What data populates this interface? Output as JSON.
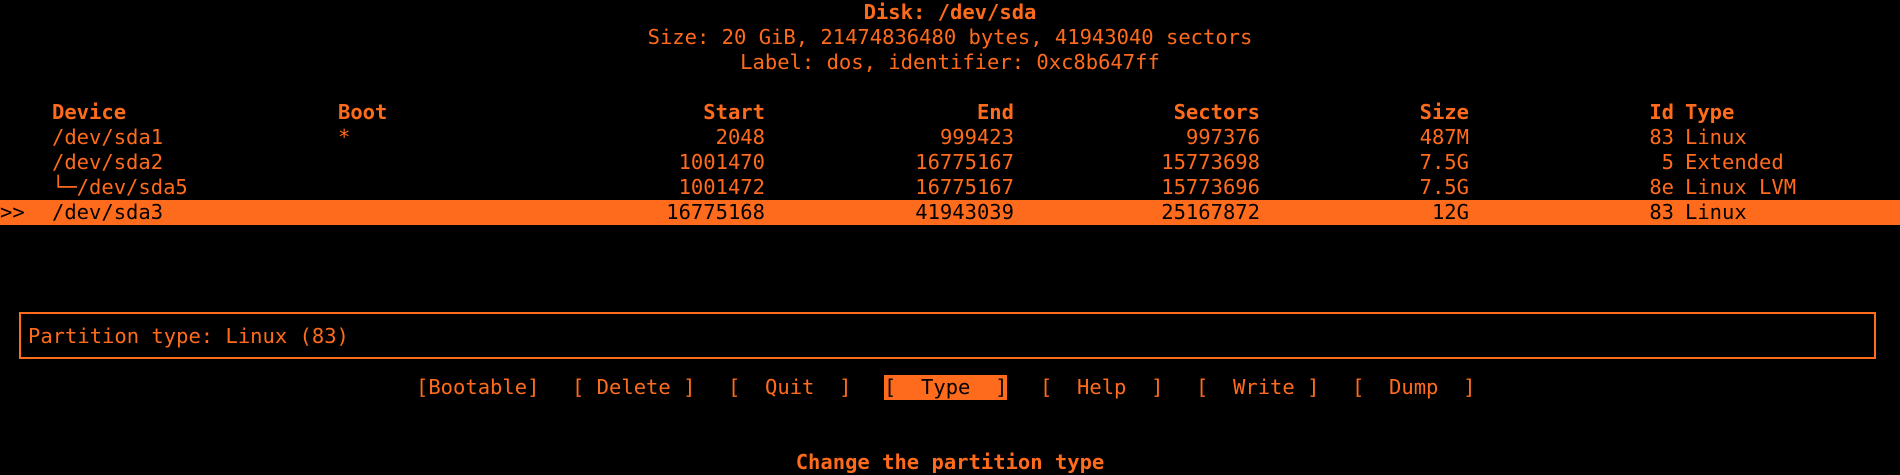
{
  "disk": {
    "title": "Disk: /dev/sda",
    "size_line": "Size: 20 GiB, 21474836480 bytes, 41943040 sectors",
    "label_line": "Label: dos, identifier: 0xc8b647ff"
  },
  "table": {
    "headers": {
      "device": "Device",
      "boot": "Boot",
      "start": "Start",
      "end": "End",
      "sectors": "Sectors",
      "size": "Size",
      "id": "Id",
      "type": "Type"
    },
    "rows": [
      {
        "marker": "",
        "device": "/dev/sda1",
        "boot": "*",
        "start": "2048",
        "end": "999423",
        "sectors": "997376",
        "size": "487M",
        "id": "83",
        "type": "Linux"
      },
      {
        "marker": "",
        "device": "/dev/sda2",
        "boot": "",
        "start": "1001470",
        "end": "16775167",
        "sectors": "15773698",
        "size": "7.5G",
        "id": "5",
        "type": "Extended"
      },
      {
        "marker": "",
        "device": "└─/dev/sda5",
        "boot": "",
        "start": "1001472",
        "end": "16775167",
        "sectors": "15773696",
        "size": "7.5G",
        "id": "8e",
        "type": "Linux LVM"
      },
      {
        "marker": ">>",
        "device": "/dev/sda3",
        "boot": "",
        "start": "16775168",
        "end": "41943039",
        "sectors": "25167872",
        "size": "12G",
        "id": "83",
        "type": "Linux"
      }
    ]
  },
  "info": {
    "text": "Partition type: Linux (83)"
  },
  "menu": {
    "bootable": "[Bootable]",
    "delete": "[ Delete ]",
    "quit": "[  Quit  ]",
    "type": "[  Type  ]",
    "help": "[  Help  ]",
    "write": "[  Write ]",
    "dump": "[  Dump  ]"
  },
  "footer": {
    "hint": "Change the partition type"
  },
  "colors": {
    "foreground": "#ff6b1c",
    "background": "#000000"
  }
}
